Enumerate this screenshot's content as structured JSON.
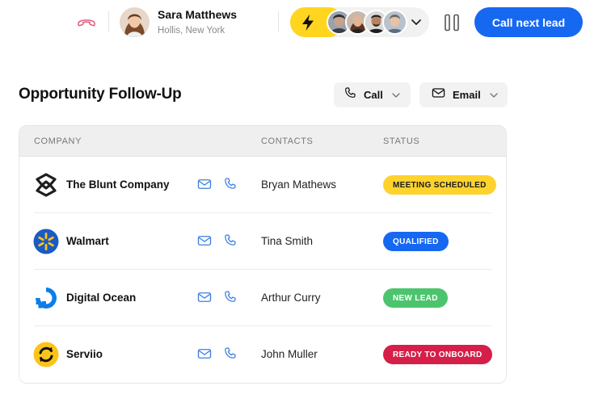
{
  "agent": {
    "name": "Sara Matthews",
    "location": "Hollis, New York"
  },
  "header": {
    "call_next_lead": "Call next lead"
  },
  "icons": {
    "hangup": "phone-hangup-icon",
    "bolt": "lightning-bolt-icon",
    "chevron": "chevron-down-icon",
    "pause": "pause-icon",
    "mail": "envelope-icon",
    "phone": "phone-icon"
  },
  "page": {
    "title": "Opportunity Follow-Up"
  },
  "actions": {
    "call_label": "Call",
    "email_label": "Email"
  },
  "table": {
    "headers": {
      "company": "COMPANY",
      "contacts": "CONTACTS",
      "status": "STATUS"
    },
    "rows": [
      {
        "company": "The Blunt Company",
        "contact": "Bryan Mathews",
        "status": "MEETING SCHEDULED",
        "status_bg": "#ffd22e",
        "status_fg": "#1a1a1a"
      },
      {
        "company": "Walmart",
        "contact": "Tina Smith",
        "status": "QUALIFIED",
        "status_bg": "#1668f1",
        "status_fg": "#ffffff"
      },
      {
        "company": "Digital Ocean",
        "contact": "Arthur Curry",
        "status": "NEW LEAD",
        "status_bg": "#4cc46e",
        "status_fg": "#ffffff"
      },
      {
        "company": "Serviio",
        "contact": "John Muller",
        "status": "READY TO ONBOARD",
        "status_bg": "#d51f48",
        "status_fg": "#ffffff"
      }
    ]
  },
  "colors": {
    "accent": "#1668f1",
    "bolt": "#ffd51f",
    "hangup": "#e0607e",
    "icon_blue": "#3d7fe0"
  }
}
